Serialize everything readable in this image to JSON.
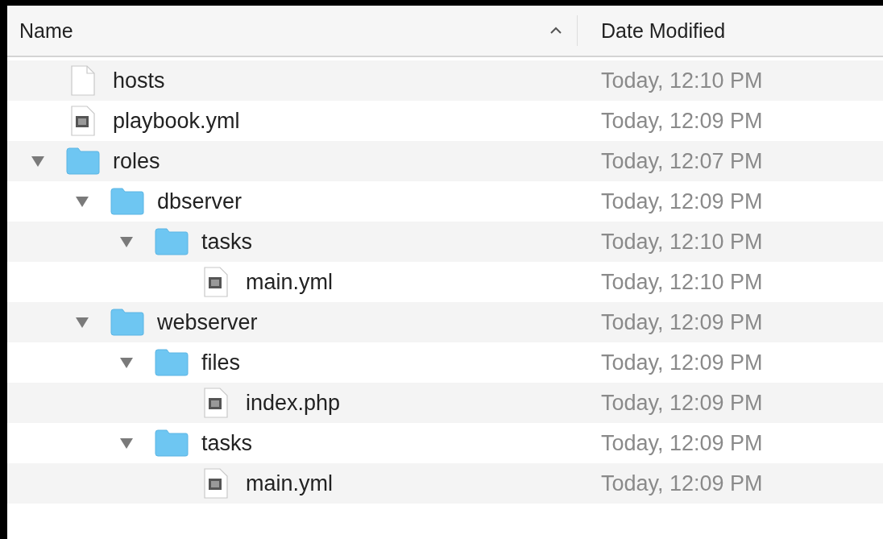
{
  "columns": [
    {
      "label": "Name",
      "sorted": true
    },
    {
      "label": "Date Modified",
      "sorted": false
    }
  ],
  "items": [
    {
      "name": "hosts",
      "kind": "text",
      "modified": "Today, 12:10 PM"
    },
    {
      "name": "playbook.yml",
      "kind": "document",
      "modified": "Today, 12:09 PM"
    },
    {
      "name": "roles",
      "kind": "folder",
      "expanded": true,
      "modified": "Today, 12:07 PM",
      "children": [
        {
          "name": "dbserver",
          "kind": "folder",
          "expanded": true,
          "modified": "Today, 12:09 PM",
          "children": [
            {
              "name": "tasks",
              "kind": "folder",
              "expanded": true,
              "modified": "Today, 12:10 PM",
              "children": [
                {
                  "name": "main.yml",
                  "kind": "document",
                  "modified": "Today, 12:10 PM"
                }
              ]
            }
          ]
        },
        {
          "name": "webserver",
          "kind": "folder",
          "expanded": true,
          "modified": "Today, 12:09 PM",
          "children": [
            {
              "name": "files",
              "kind": "folder",
              "expanded": true,
              "modified": "Today, 12:09 PM",
              "children": [
                {
                  "name": "index.php",
                  "kind": "document",
                  "modified": "Today, 12:09 PM"
                }
              ]
            },
            {
              "name": "tasks",
              "kind": "folder",
              "expanded": true,
              "modified": "Today, 12:09 PM",
              "children": [
                {
                  "name": "main.yml",
                  "kind": "document",
                  "modified": "Today, 12:09 PM"
                }
              ]
            }
          ]
        }
      ]
    }
  ]
}
